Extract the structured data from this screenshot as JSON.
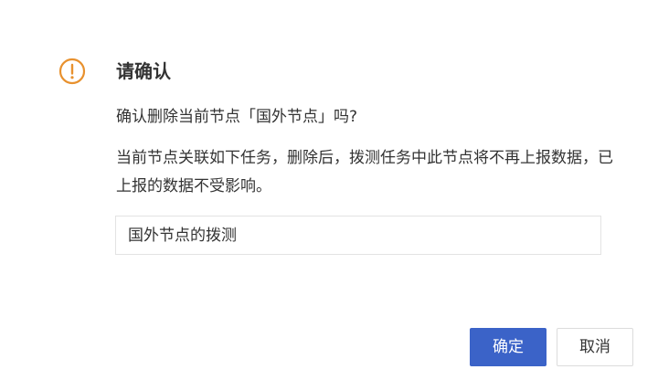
{
  "dialog": {
    "icon": "exclamation-circle-icon",
    "accent_color": "#e8912e",
    "title": "请确认",
    "question": "确认删除当前节点「国外节点」吗?",
    "description": "当前节点关联如下任务，删除后，拨测任务中此节点将不再上报数据，已上报的数据不受影响。",
    "tasks": [
      "国外节点的拨测"
    ],
    "confirm_label": "确定",
    "cancel_label": "取消",
    "primary_color": "#3b63c8"
  }
}
